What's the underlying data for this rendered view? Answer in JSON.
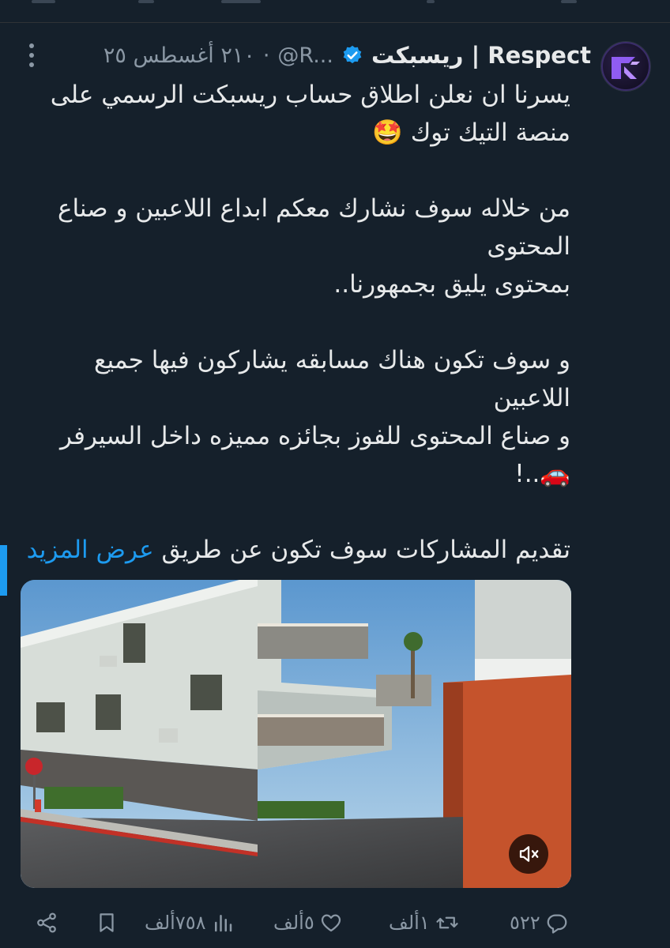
{
  "tweet": {
    "display_name": "ريسبكت | Respect",
    "handle": "@R...",
    "separator": "·",
    "timestamp": "٢١٠ أغسطس ٢٥",
    "lines": [
      "يسرنا ان نعلن اطلاق حساب ريسبكت الرسمي على",
      "منصة التيك توك 🤩",
      "",
      "من خلاله سوف نشارك معكم ابداع اللاعبين و صناع",
      "المحتوى",
      "بمحتوى يليق بجمهورنا..",
      "",
      "و سوف تكون هناك مسابقه يشاركون فيها جميع",
      "اللاعبين",
      "و صناع المحتوى للفوز بجائزه مميزه داخل السيرفر",
      "🚗..!",
      "",
      "تقديم المشاركات سوف تكون عن طريق"
    ],
    "show_more": "عرض المزيد"
  },
  "icons": {
    "verified": "verified-badge-icon",
    "more": "more-options-icon",
    "mute": "mute-icon",
    "reply": "reply-icon",
    "retweet": "retweet-icon",
    "like": "like-icon",
    "views": "views-icon",
    "bookmark": "bookmark-icon",
    "share": "share-icon"
  },
  "actions": {
    "replies": "٥٢٢",
    "retweets": "١ألف",
    "likes": "٥ألف",
    "views": "٧٥٨ألف"
  },
  "colors": {
    "background": "#15202b",
    "text": "#e7e9ea",
    "muted": "#8b98a5",
    "accent": "#1d9bf0"
  }
}
